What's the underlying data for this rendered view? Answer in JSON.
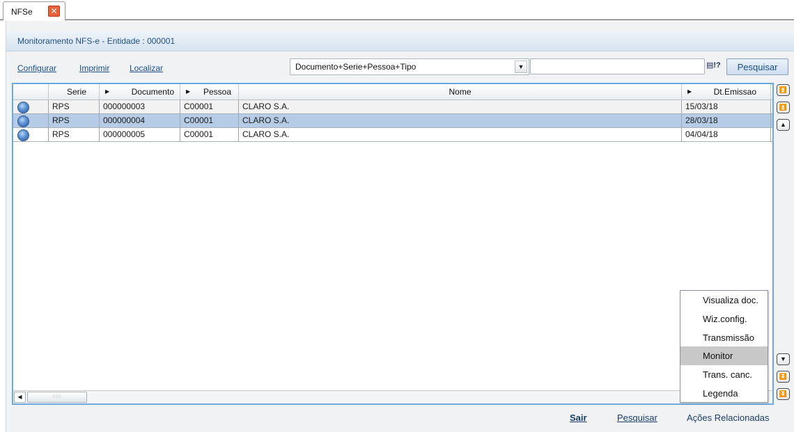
{
  "tab": {
    "label": "NFSe",
    "close_glyph": "✕"
  },
  "panel": {
    "title": "Monitoramento NFS-e - Entidade : 000001"
  },
  "toolbar": {
    "links": [
      "Configurar",
      "Imprimir",
      "Localizar"
    ],
    "order_combo": {
      "value": "Documento+Serie+Pessoa+Tipo"
    },
    "search_value": "",
    "filter_icon_glyph": "▤!?",
    "search_button": "Pesquisar"
  },
  "grid": {
    "columns": [
      "",
      "Serie",
      "Documento",
      "Pessoa",
      "Nome",
      "Dt.Emissao"
    ],
    "rows": [
      {
        "serie": "RPS",
        "documento": "000000003",
        "pessoa": "C00001",
        "nome": "CLARO S.A.",
        "dt_emissao": "15/03/18",
        "selected": false
      },
      {
        "serie": "RPS",
        "documento": "000000004",
        "pessoa": "C00001",
        "nome": "CLARO S.A.",
        "dt_emissao": "28/03/18",
        "selected": true
      },
      {
        "serie": "RPS",
        "documento": "000000005",
        "pessoa": "C00001",
        "nome": "CLARO S.A.",
        "dt_emissao": "04/04/18",
        "selected": false
      }
    ]
  },
  "context_menu": {
    "items": [
      "Visualiza doc.",
      "Wiz.config.",
      "Transmissão",
      "Monitor",
      "Trans. canc.",
      "Legenda"
    ],
    "highlighted": "Monitor"
  },
  "footer": {
    "sair": "Sair",
    "pesquisar": "Pesquisar",
    "acoes": "Ações Relacionadas"
  },
  "colors": {
    "accent": "#6aa9e4",
    "selected_row": "#b5cbe6",
    "link": "#1a4f8a"
  }
}
